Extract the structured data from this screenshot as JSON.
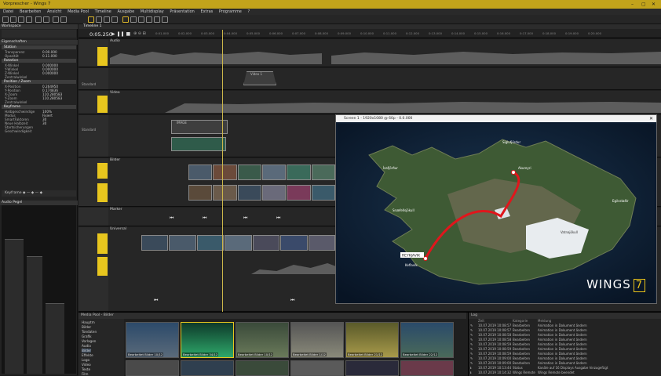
{
  "window": {
    "title": "Vorprescher - Wings 7",
    "controls": [
      "–",
      "▢",
      "✕"
    ]
  },
  "menu": [
    "Datei",
    "Bearbeiten",
    "Ansicht",
    "Media Pool",
    "Timeline",
    "Ausgabe",
    "Multidisplay",
    "Präsentation",
    "Extras",
    "Programme",
    "?"
  ],
  "left": {
    "workspace_label": "Workspace",
    "eigenschaften_label": "Eigenschaften",
    "sections": [
      {
        "title": "Station",
        "rows": [
          [
            "Transparenz",
            "0.00.000"
          ],
          [
            "Opazität",
            "0.11.000"
          ]
        ]
      },
      {
        "title": "Rotation",
        "rows": [
          [
            "X-Winkel",
            "0.000000"
          ],
          [
            "Y-Winkel",
            "0.000000"
          ],
          [
            "Z-Winkel",
            "0.000000"
          ],
          [
            "Zentralwinkel",
            ""
          ]
        ]
      },
      {
        "title": "Position / Zoom",
        "rows": [
          [
            "X-Position",
            "0.264950"
          ],
          [
            "Y-Position",
            "0.174836"
          ],
          [
            "X-Zoom",
            "110.280583"
          ],
          [
            "Y-Zoom",
            "110.280583"
          ],
          [
            "Zentralwinkel",
            ""
          ]
        ]
      },
      {
        "title": "Keyframe",
        "rows": [
          [
            "Halbgeschwindige",
            "100%"
          ],
          [
            "Modus",
            "Fixiert"
          ],
          [
            "SmartFaktoren",
            "30"
          ],
          [
            "Neue Halbzeit",
            "30"
          ],
          [
            "Startsicherungen",
            ""
          ],
          [
            "Geschwindigkeit",
            ""
          ]
        ]
      }
    ],
    "keyframe_nav": "Keyframe",
    "audio_meter_label": "Audio Pegel"
  },
  "timeline": {
    "tab": "Timeline 1",
    "timecode": "0:05.250",
    "ticks": [
      "0:01.000",
      "0:02.000",
      "0:03.000",
      "0:04.000",
      "0:05.000",
      "0:06.000",
      "0:07.000",
      "0:08.000",
      "0:09.000",
      "0:10.000",
      "0:11.000",
      "0:12.000",
      "0:13.000",
      "0:14.000",
      "0:15.000",
      "0:16.000",
      "0:17.000",
      "0:18.000",
      "0:19.000",
      "0:20.000"
    ],
    "tracks": {
      "audio": "Audio",
      "video": "Video",
      "bilder": "Bilder",
      "marker": "Marker",
      "universal": "Universal"
    },
    "standard": "Standard",
    "clip_video": "Video 1",
    "clip_image": "IMAGE"
  },
  "preview": {
    "title": "Screen 1 - 1920x1080 @ 60p - 0.0.000",
    "logo": "WINGS",
    "logo_num": "7",
    "places": [
      "Siglufjördur",
      "Akureyri",
      "Egilsstaðir",
      "Vatnajökull",
      "Snæfellsjökull",
      "REYKJAVIK",
      "Keflavík",
      "Ísafjörður"
    ]
  },
  "media_pool": {
    "title": "Media Pool - Bilder",
    "tree": [
      "Hauptm",
      "Bilder",
      "Tondaten",
      "Grafik",
      "Vorlagen",
      "Audio",
      "Bilder",
      "Effekte",
      "Logo",
      "Video",
      "Texte",
      "Film"
    ],
    "thumbs": [
      "Bearbeitet Bilder 10/12",
      "Bearbeitet Bilder 34/12",
      "Bearbeitet Bilder 10/12",
      "Bearbeitet Bilder 1/12",
      "Bearbeitet Bilder 21/12",
      "Bearbeitet Bilder 22/12"
    ]
  },
  "log": {
    "title": "Log",
    "cols": [
      "Zeit",
      "Kategorie",
      "Meldung"
    ],
    "rows": [
      [
        "10.07.2019 10:08:57",
        "Bearbeiten",
        "Animation in Dokument ändern"
      ],
      [
        "10.07.2019 10:08:57",
        "Bearbeiten",
        "Animation in Dokument ändern"
      ],
      [
        "10.07.2019 10:08:58",
        "Bearbeiten",
        "Animation in Dokument ändern"
      ],
      [
        "10.07.2019 10:08:58",
        "Bearbeiten",
        "Animation in Dokument ändern"
      ],
      [
        "10.07.2019 10:08:59",
        "Bearbeiten",
        "Animation in Dokument ändern"
      ],
      [
        "10.07.2019 10:08:59",
        "Bearbeiten",
        "Animation in Dokument ändern"
      ],
      [
        "10.07.2019 10:08:59",
        "Bearbeiten",
        "Animation in Dokument ändern"
      ],
      [
        "10.07.2019 10:09:00",
        "Bearbeiten",
        "Animation in Dokument ändern"
      ],
      [
        "10.07.2019 10:09:00",
        "Bearbeiten",
        "Animation in Dokument ändern"
      ],
      [
        "10.07.2019 10:13:44",
        "Status",
        "Kanäle auf 16 Displays Ausgabe hinzugefügt"
      ],
      [
        "10.07.2019 10:14:32",
        "Wings Remote",
        "Wings Remote beendet"
      ]
    ]
  },
  "colors": {
    "accent": "#e8c61e",
    "title": "#c2a31b",
    "route": "#e0161c"
  }
}
